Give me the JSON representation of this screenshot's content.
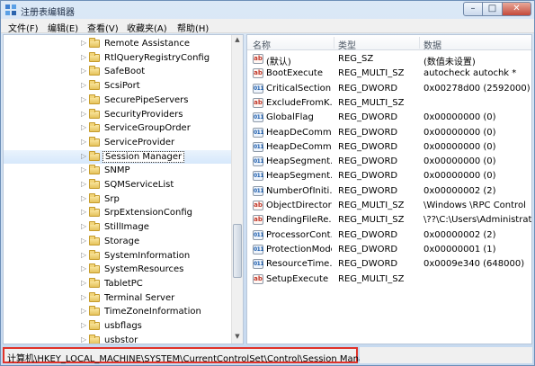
{
  "window": {
    "title": "注册表编辑器"
  },
  "menu": [
    {
      "label": "文件(F)"
    },
    {
      "label": "编辑(E)"
    },
    {
      "label": "查看(V)"
    },
    {
      "label": "收藏夹(A)"
    },
    {
      "label": "帮助(H)"
    }
  ],
  "tree": {
    "selected": "Session Manager",
    "items": [
      {
        "label": "Remote Assistance"
      },
      {
        "label": "RtlQueryRegistryConfig"
      },
      {
        "label": "SafeBoot"
      },
      {
        "label": "ScsiPort"
      },
      {
        "label": "SecurePipeServers"
      },
      {
        "label": "SecurityProviders"
      },
      {
        "label": "ServiceGroupOrder"
      },
      {
        "label": "ServiceProvider"
      },
      {
        "label": "Session Manager"
      },
      {
        "label": "SNMP"
      },
      {
        "label": "SQMServiceList"
      },
      {
        "label": "Srp"
      },
      {
        "label": "SrpExtensionConfig"
      },
      {
        "label": "StillImage"
      },
      {
        "label": "Storage"
      },
      {
        "label": "SystemInformation"
      },
      {
        "label": "SystemResources"
      },
      {
        "label": "TabletPC"
      },
      {
        "label": "Terminal Server"
      },
      {
        "label": "TimeZoneInformation"
      },
      {
        "label": "usbflags"
      },
      {
        "label": "usbstor"
      }
    ]
  },
  "list": {
    "columns": {
      "name": "名称",
      "type": "类型",
      "data": "数据"
    },
    "rows": [
      {
        "icon": "string-value-icon",
        "name": "(默认)",
        "type": "REG_SZ",
        "data": "(数值未设置)"
      },
      {
        "icon": "string-value-icon",
        "name": "BootExecute",
        "type": "REG_MULTI_SZ",
        "data": "autocheck autochk *"
      },
      {
        "icon": "binary-value-icon",
        "name": "CriticalSection...",
        "type": "REG_DWORD",
        "data": "0x00278d00 (2592000)"
      },
      {
        "icon": "string-value-icon",
        "name": "ExcludeFromK...",
        "type": "REG_MULTI_SZ",
        "data": ""
      },
      {
        "icon": "binary-value-icon",
        "name": "GlobalFlag",
        "type": "REG_DWORD",
        "data": "0x00000000 (0)"
      },
      {
        "icon": "binary-value-icon",
        "name": "HeapDeComm...",
        "type": "REG_DWORD",
        "data": "0x00000000 (0)"
      },
      {
        "icon": "binary-value-icon",
        "name": "HeapDeComm...",
        "type": "REG_DWORD",
        "data": "0x00000000 (0)"
      },
      {
        "icon": "binary-value-icon",
        "name": "HeapSegment...",
        "type": "REG_DWORD",
        "data": "0x00000000 (0)"
      },
      {
        "icon": "binary-value-icon",
        "name": "HeapSegment...",
        "type": "REG_DWORD",
        "data": "0x00000000 (0)"
      },
      {
        "icon": "binary-value-icon",
        "name": "NumberOfIniti...",
        "type": "REG_DWORD",
        "data": "0x00000002 (2)"
      },
      {
        "icon": "string-value-icon",
        "name": "ObjectDirector...",
        "type": "REG_MULTI_SZ",
        "data": "\\Windows \\RPC Control"
      },
      {
        "icon": "string-value-icon",
        "name": "PendingFileRe...",
        "type": "REG_MULTI_SZ",
        "data": "\\??\\C:\\Users\\Administrator"
      },
      {
        "icon": "binary-value-icon",
        "name": "ProcessorCont...",
        "type": "REG_DWORD",
        "data": "0x00000002 (2)"
      },
      {
        "icon": "binary-value-icon",
        "name": "ProtectionMode",
        "type": "REG_DWORD",
        "data": "0x00000001 (1)"
      },
      {
        "icon": "binary-value-icon",
        "name": "ResourceTime...",
        "type": "REG_DWORD",
        "data": "0x0009e340 (648000)"
      },
      {
        "icon": "string-value-icon",
        "name": "SetupExecute",
        "type": "REG_MULTI_SZ",
        "data": ""
      }
    ]
  },
  "status": {
    "path": "计算机\\HKEY_LOCAL_MACHINE\\SYSTEM\\CurrentControlSet\\Control\\Session Manager"
  },
  "colors": {
    "status_highlight": "#e0332a",
    "selection": "#d6e8fb"
  }
}
